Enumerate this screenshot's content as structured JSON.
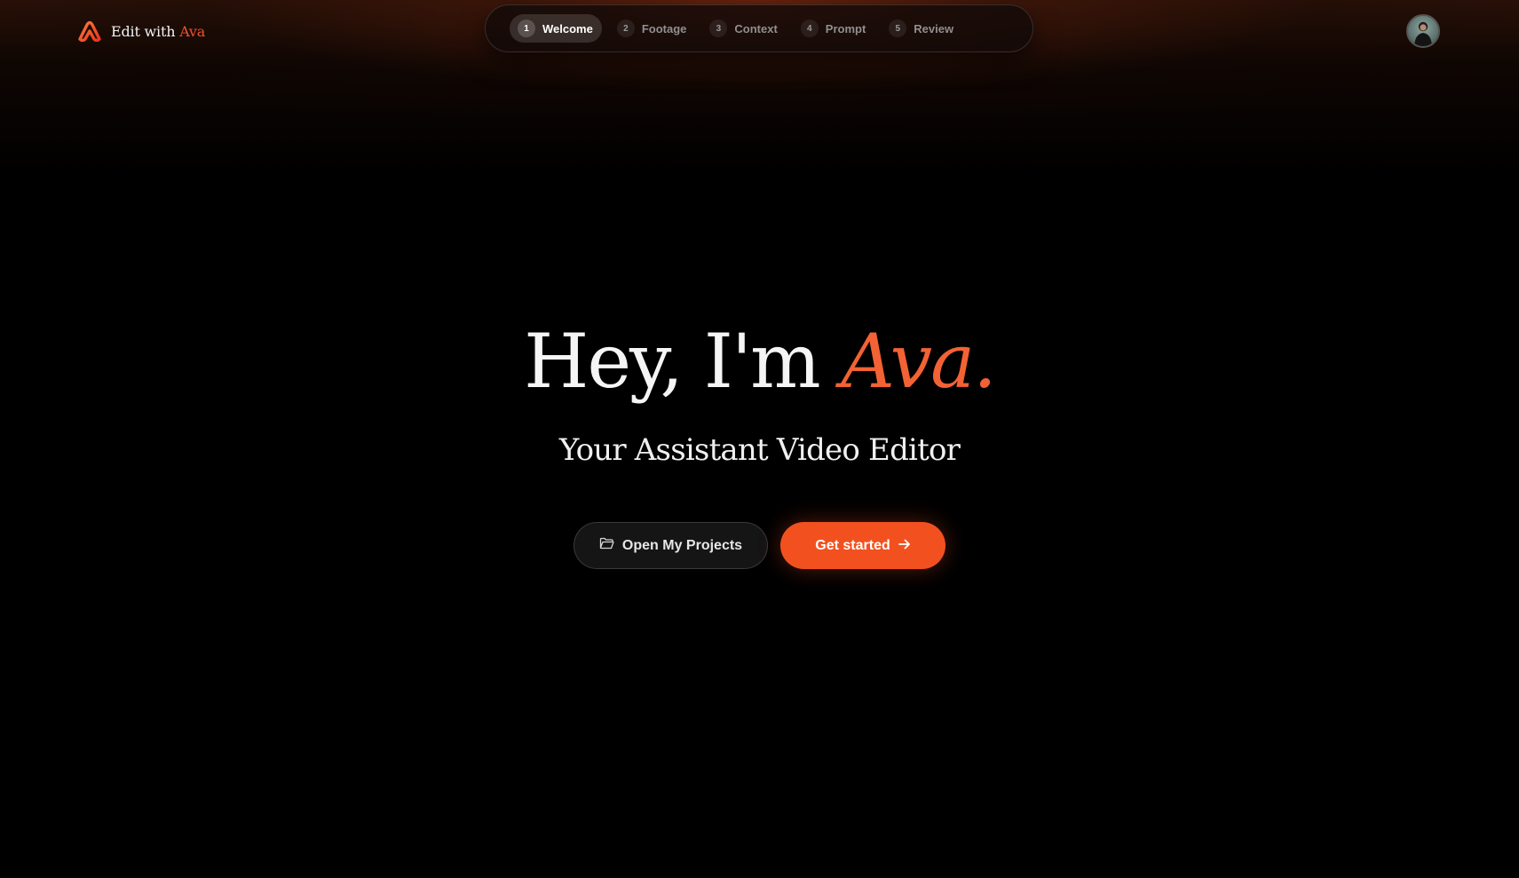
{
  "brand": {
    "prefix": "Edit with",
    "accent": "Ava",
    "icon": "ava-logo-icon",
    "accent_color": "#f0522a"
  },
  "stepper": {
    "steps": [
      {
        "number": "1",
        "label": "Welcome",
        "active": true
      },
      {
        "number": "2",
        "label": "Footage",
        "active": false
      },
      {
        "number": "3",
        "label": "Context",
        "active": false
      },
      {
        "number": "4",
        "label": "Prompt",
        "active": false
      },
      {
        "number": "5",
        "label": "Review",
        "active": false
      }
    ]
  },
  "user": {
    "avatar_icon": "user-avatar"
  },
  "hero": {
    "title_prefix": "Hey, I'm",
    "title_name": "Ava.",
    "subtitle": "Your Assistant Video Editor"
  },
  "actions": {
    "open_projects_label": "Open My Projects",
    "open_projects_icon": "folder-icon",
    "get_started_label": "Get started",
    "get_started_icon": "arrow-right-icon",
    "primary_color": "#f2511f"
  }
}
